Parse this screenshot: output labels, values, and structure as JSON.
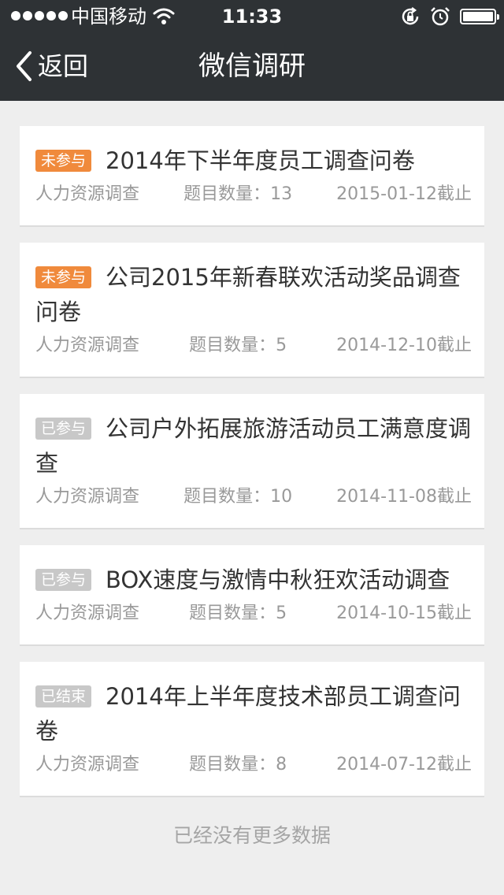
{
  "status_bar": {
    "carrier": "中国移动",
    "time": "11:33"
  },
  "nav": {
    "back_label": "返回",
    "title": "微信调研"
  },
  "meta_labels": {
    "question_count_prefix": "题目数量："
  },
  "surveys": [
    {
      "badge": "未参与",
      "badge_color": "#f08a3c",
      "title": "2014年下半年度员工调查问卷",
      "category": "人力资源调查",
      "question_count": "题目数量：13",
      "deadline": "2015-01-12截止"
    },
    {
      "badge": "未参与",
      "badge_color": "#f08a3c",
      "title": "公司2015年新春联欢活动奖品调查问卷",
      "category": "人力资源调查",
      "question_count": "题目数量：5",
      "deadline": "2014-12-10截止"
    },
    {
      "badge": "已参与",
      "badge_color": "#c8c8c8",
      "title": "公司户外拓展旅游活动员工满意度调查",
      "category": "人力资源调查",
      "question_count": "题目数量：10",
      "deadline": "2014-11-08截止"
    },
    {
      "badge": "已参与",
      "badge_color": "#c8c8c8",
      "title": "BOX速度与激情中秋狂欢活动调查",
      "category": "人力资源调查",
      "question_count": "题目数量：5",
      "deadline": "2014-10-15截止"
    },
    {
      "badge": "已结束",
      "badge_color": "#c8c8c8",
      "title": "2014年上半年度技术部员工调查问卷",
      "category": "人力资源调查",
      "question_count": "题目数量：8",
      "deadline": "2014-07-12截止"
    }
  ],
  "footer_text": "已经没有更多数据"
}
